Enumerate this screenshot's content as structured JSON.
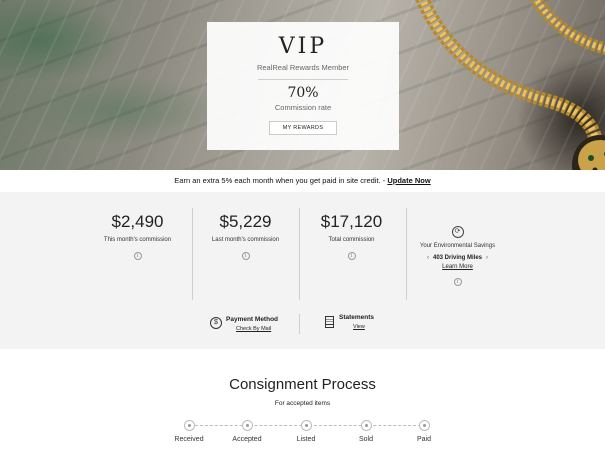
{
  "hero": {
    "tier": "VIP",
    "member_label": "RealReal Rewards Member",
    "commission_rate": "70%",
    "commission_rate_label": "Commission rate",
    "rewards_button": "MY REWARDS"
  },
  "promo": {
    "text": "Earn an extra 5% each month when you get paid in site credit. -",
    "link": "Update Now"
  },
  "stats": [
    {
      "value": "$2,490",
      "label": "This month's commission"
    },
    {
      "value": "$5,229",
      "label": "Last month's commission"
    },
    {
      "value": "$17,120",
      "label": "Total commission"
    }
  ],
  "environment": {
    "label": "Your Environmental Savings",
    "miles": "403 Driving Miles",
    "link": "Learn More",
    "icon": "recycle-car-icon"
  },
  "payment": {
    "title": "Payment Method",
    "link": "Check By Mail",
    "icon": "dollar-icon"
  },
  "statements": {
    "title": "Statements",
    "link": "View",
    "icon": "document-icon"
  },
  "consignment": {
    "title": "Consignment Process",
    "subtitle": "For accepted items",
    "steps": [
      "Received",
      "Accepted",
      "Listed",
      "Sold",
      "Paid"
    ]
  }
}
